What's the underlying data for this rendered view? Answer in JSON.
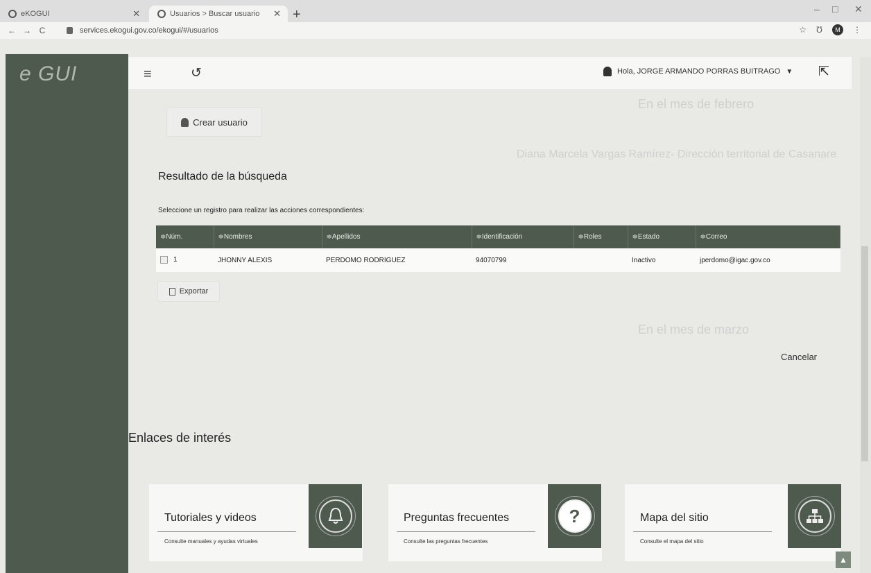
{
  "browser": {
    "tab1_title": "eKOGUI",
    "tab2_title": "Usuarios > Buscar usuario",
    "url": "services.ekogui.gov.co/ekogui/#/usuarios",
    "profile_initial": "M"
  },
  "app": {
    "logo_text": "e GUI",
    "greeting": "Hola, JORGE ARMANDO PORRAS BUITRAGO"
  },
  "actions": {
    "create_user": "Crear usuario",
    "export": "Exportar",
    "cancel": "Cancelar"
  },
  "results": {
    "heading": "Resultado de la búsqueda",
    "instruction": "Seleccione un registro para realizar las acciones correspondientes:",
    "columns": [
      "≑Núm.",
      "≑Nombres",
      "≑Apellidos",
      "≑Identificación",
      "≑Roles",
      "≑Estado",
      "≑Correo"
    ],
    "rows": [
      {
        "num": "1",
        "nombres": "JHONNY ALEXIS",
        "apellidos": "PERDOMO RODRIGUEZ",
        "identificacion": "94070799",
        "roles": "",
        "estado": "Inactivo",
        "correo": "jperdomo@igac.gov.co"
      }
    ]
  },
  "links": {
    "heading": "Enlaces de interés",
    "cards": [
      {
        "title": "Tutoriales y videos",
        "desc": "Consulte manuales y ayudas virtuales",
        "icon": "bell-icon"
      },
      {
        "title": "Preguntas frecuentes",
        "desc": "Consulte las preguntas frecuentes",
        "icon": "question-icon"
      },
      {
        "title": "Mapa del sitio",
        "desc": "Consulte el mapa del sitio",
        "icon": "sitemap-icon"
      }
    ]
  },
  "background_text": {
    "line1": "En el mes de febrero",
    "line2": "Diana Marcela Vargas Ramírez- Dirección territorial de Casanare",
    "line3": "En el mes de marzo"
  }
}
